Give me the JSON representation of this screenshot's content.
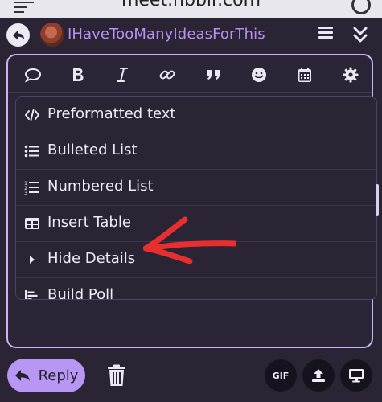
{
  "browser": {
    "url": "meet.hbblr.com"
  },
  "reply_header": {
    "username": "IHaveTooManyIdeasForThis"
  },
  "toolbar": {
    "tools": [
      "speech-bubble-icon",
      "bold-icon",
      "italic-icon",
      "link-icon",
      "quote-icon",
      "emoji-icon",
      "calendar-icon",
      "gear-icon"
    ]
  },
  "menu": {
    "items": [
      {
        "label": "Preformatted text",
        "icon": "code-icon"
      },
      {
        "label": "Bulleted List",
        "icon": "bullet-list-icon"
      },
      {
        "label": "Numbered List",
        "icon": "numbered-list-icon"
      },
      {
        "label": "Insert Table",
        "icon": "table-icon"
      },
      {
        "label": "Hide Details",
        "icon": "disclosure-triangle-icon"
      },
      {
        "label": "Build Poll",
        "icon": "poll-icon"
      }
    ]
  },
  "actions": {
    "reply_label": "Reply",
    "gif_label": "GIF"
  },
  "colors": {
    "accent": "#b896f3",
    "background": "#2a2434",
    "annotation": "#e72f2f"
  }
}
